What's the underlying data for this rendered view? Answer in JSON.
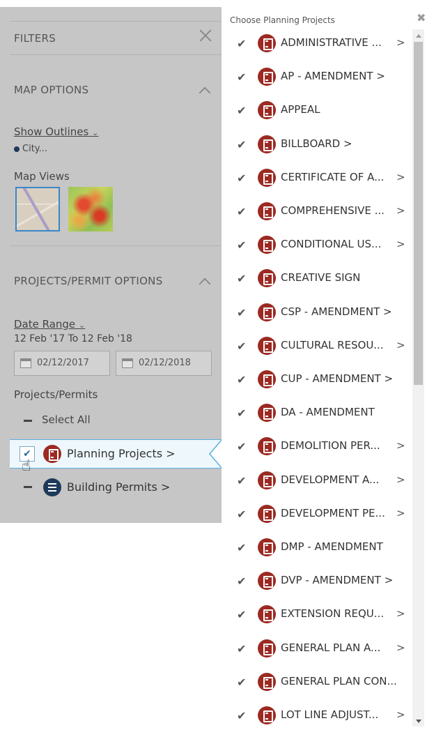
{
  "filters": {
    "title": "FILTERS",
    "map_options": {
      "heading": "MAP OPTIONS",
      "show_outlines_label": "Show Outlines",
      "outline_value": "City...",
      "map_views_label": "Map Views"
    },
    "project_options": {
      "heading": "PROJECTS/PERMIT OPTIONS",
      "date_range_label": "Date Range",
      "date_range_text": "12 Feb '17 To 12 Feb '18",
      "start_date": "02/12/2017",
      "end_date": "02/12/2018",
      "projects_label": "Projects/Permits",
      "select_all": "Select All",
      "planning_projects": "Planning Projects",
      "building_permits": "Building Permits",
      "chevron": ">"
    }
  },
  "popup": {
    "title": "Choose Planning Projects",
    "items": [
      {
        "label": "ADMINISTRATIVE ...",
        "arrow": ">"
      },
      {
        "label": "AP - AMENDMENT >",
        "arrow": ""
      },
      {
        "label": "APPEAL",
        "arrow": ""
      },
      {
        "label": "BILLBOARD >",
        "arrow": ""
      },
      {
        "label": "CERTIFICATE OF A...",
        "arrow": ">"
      },
      {
        "label": "COMPREHENSIVE ...",
        "arrow": ">"
      },
      {
        "label": "CONDITIONAL US...",
        "arrow": ">"
      },
      {
        "label": "CREATIVE SIGN",
        "arrow": ""
      },
      {
        "label": "CSP - AMENDMENT >",
        "arrow": ""
      },
      {
        "label": "CULTURAL RESOU...",
        "arrow": ">"
      },
      {
        "label": "CUP - AMENDMENT >",
        "arrow": ""
      },
      {
        "label": "DA - AMENDMENT",
        "arrow": ""
      },
      {
        "label": "DEMOLITION PER...",
        "arrow": ">"
      },
      {
        "label": "DEVELOPMENT A...",
        "arrow": ">"
      },
      {
        "label": "DEVELOPMENT PE...",
        "arrow": ">"
      },
      {
        "label": "DMP - AMENDMENT",
        "arrow": ""
      },
      {
        "label": "DVP - AMENDMENT >",
        "arrow": ""
      },
      {
        "label": "EXTENSION REQU...",
        "arrow": ">"
      },
      {
        "label": "GENERAL PLAN A...",
        "arrow": ">"
      },
      {
        "label": "GENERAL PLAN CON...",
        "arrow": ""
      },
      {
        "label": "LOT LINE ADJUST...",
        "arrow": ">"
      }
    ]
  },
  "colors": {
    "planning_icon": "#9b2a22",
    "building_icon": "#1e3a5a",
    "selection_border": "#5aaee0"
  }
}
